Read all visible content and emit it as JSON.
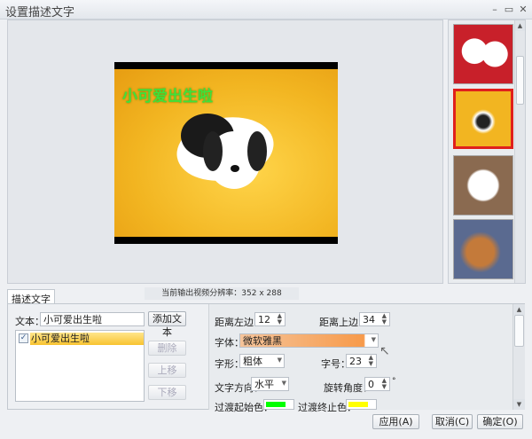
{
  "window": {
    "title": "设置描述文字",
    "minimize_icon": "minimize-icon",
    "maximize_icon": "maximize-icon",
    "close_icon": "close-icon"
  },
  "preview": {
    "overlay_text": "小可爱出生啦",
    "overlay_color": "#3fe13a"
  },
  "thumbnails": [
    {
      "label": "two white puppies",
      "selected": false
    },
    {
      "label": "puppy on yellow",
      "selected": true
    },
    {
      "label": "white puppy",
      "selected": false
    },
    {
      "label": "brown puppy",
      "selected": false
    }
  ],
  "tabs": {
    "active": "描述文字"
  },
  "resolution": "当前输出视频分辨率：352 x 288",
  "left": {
    "text_label": "文本：",
    "text_value": "小可爱出生啦",
    "add_button": "添加文本",
    "list_items": [
      {
        "label": "小可爱出生啦",
        "checked": true
      }
    ],
    "delete_button": "删除",
    "up_button": "上移",
    "down_button": "下移"
  },
  "right": {
    "left_label": "距离左边：",
    "left_value": "12",
    "top_label": "距离上边：",
    "top_value": "34",
    "font_label": "字体：",
    "font_value": "微软雅黑",
    "style_label": "字形：",
    "style_value": "粗体",
    "size_label": "字号：",
    "size_value": "23",
    "direction_label": "文字方向：",
    "direction_value": "水平",
    "rotation_label": "旋转角度：",
    "rotation_value": "0",
    "rotation_unit": "°",
    "start_color_label": "过渡起始色：",
    "start_color": "#00ff00",
    "end_color_label": "过渡终止色：",
    "end_color": "#ffff00"
  },
  "footer": {
    "apply": "应用(A)",
    "cancel": "取消(C)",
    "ok": "确定(O)"
  }
}
